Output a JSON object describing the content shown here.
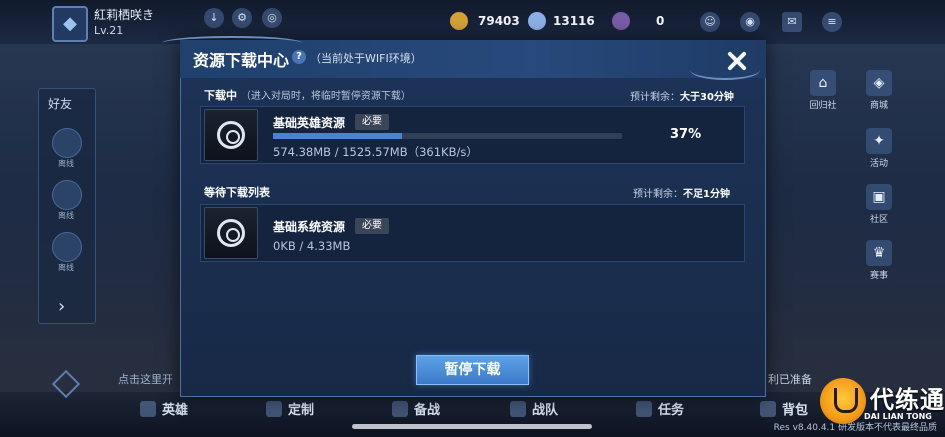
{
  "topbar": {
    "player_name": "紅莉栖咲き",
    "player_level": "Lv.21",
    "currency": [
      {
        "icon": "gold-coin-icon",
        "value": "79403"
      },
      {
        "icon": "diamond-icon",
        "value": "13116"
      },
      {
        "icon": "token-icon",
        "value": "0"
      }
    ]
  },
  "friends": {
    "title": "好友",
    "status": [
      "离线",
      "离线",
      "离线"
    ]
  },
  "right_menu": [
    "回归社",
    "商城",
    "活动",
    "社区",
    "赛事"
  ],
  "modal": {
    "title": "资源下载中心",
    "subtitle": "（当前处于WIFI环境）",
    "downloading": {
      "title": "下载中",
      "note": "（进入对局时，将临时暂停资源下载）",
      "eta_label": "预计剩余：",
      "eta_value": "大于30分钟",
      "item": {
        "name": "基础英雄资源",
        "tag": "必要",
        "size_text": "574.38MB / 1525.57MB（361KB/s）",
        "progress": 0.37,
        "percent_text": "37%"
      }
    },
    "waiting": {
      "title": "等待下载列表",
      "eta_label": "预计剩余：",
      "eta_value": "不足1分钟",
      "item": {
        "name": "基础系统资源",
        "tag": "必要",
        "size_text": "0KB / 4.33MB"
      }
    },
    "pause_label": "暂停下载"
  },
  "bottom_nav": [
    "英雄",
    "定制",
    "备战",
    "战队",
    "任务",
    "背包"
  ],
  "hints": {
    "left": "点击这里开",
    "right": "利已准备"
  },
  "version_text": "Res v8.40.4.1 研发版本不代表最终品质",
  "watermark": {
    "text": "代练通",
    "sub": "DAI LIAN TONG"
  }
}
